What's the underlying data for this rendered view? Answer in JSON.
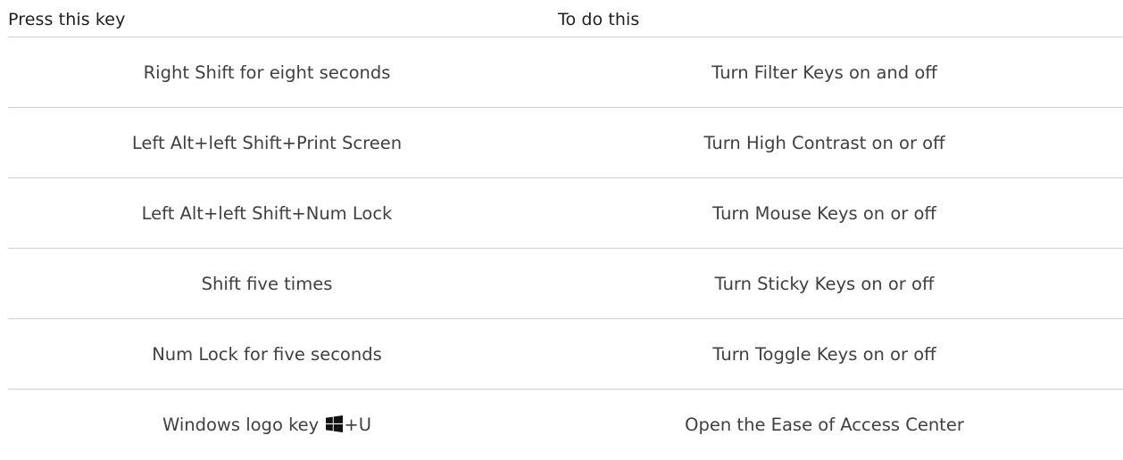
{
  "table": {
    "headers": {
      "key": "Press this key",
      "action": "To do this"
    },
    "rows": [
      {
        "key": "Right Shift for eight seconds",
        "action": "Turn Filter Keys on and off"
      },
      {
        "key": "Left Alt+left Shift+Print Screen",
        "action": "Turn High Contrast on or off"
      },
      {
        "key": "Left Alt+left Shift+Num Lock",
        "action": "Turn Mouse Keys on or off"
      },
      {
        "key": "Shift five times",
        "action": "Turn Sticky Keys on or off"
      },
      {
        "key": "Num Lock for five seconds",
        "action": "Turn Toggle Keys on or off"
      },
      {
        "key_prefix": "Windows logo key",
        "key_icon": "windows-logo-icon",
        "key_suffix": "+U",
        "action": "Open the Ease of Access Center"
      }
    ]
  },
  "colors": {
    "text": "#404040",
    "header_text": "#1e1e1e",
    "divider": "#cfcfcf",
    "background": "#ffffff"
  }
}
